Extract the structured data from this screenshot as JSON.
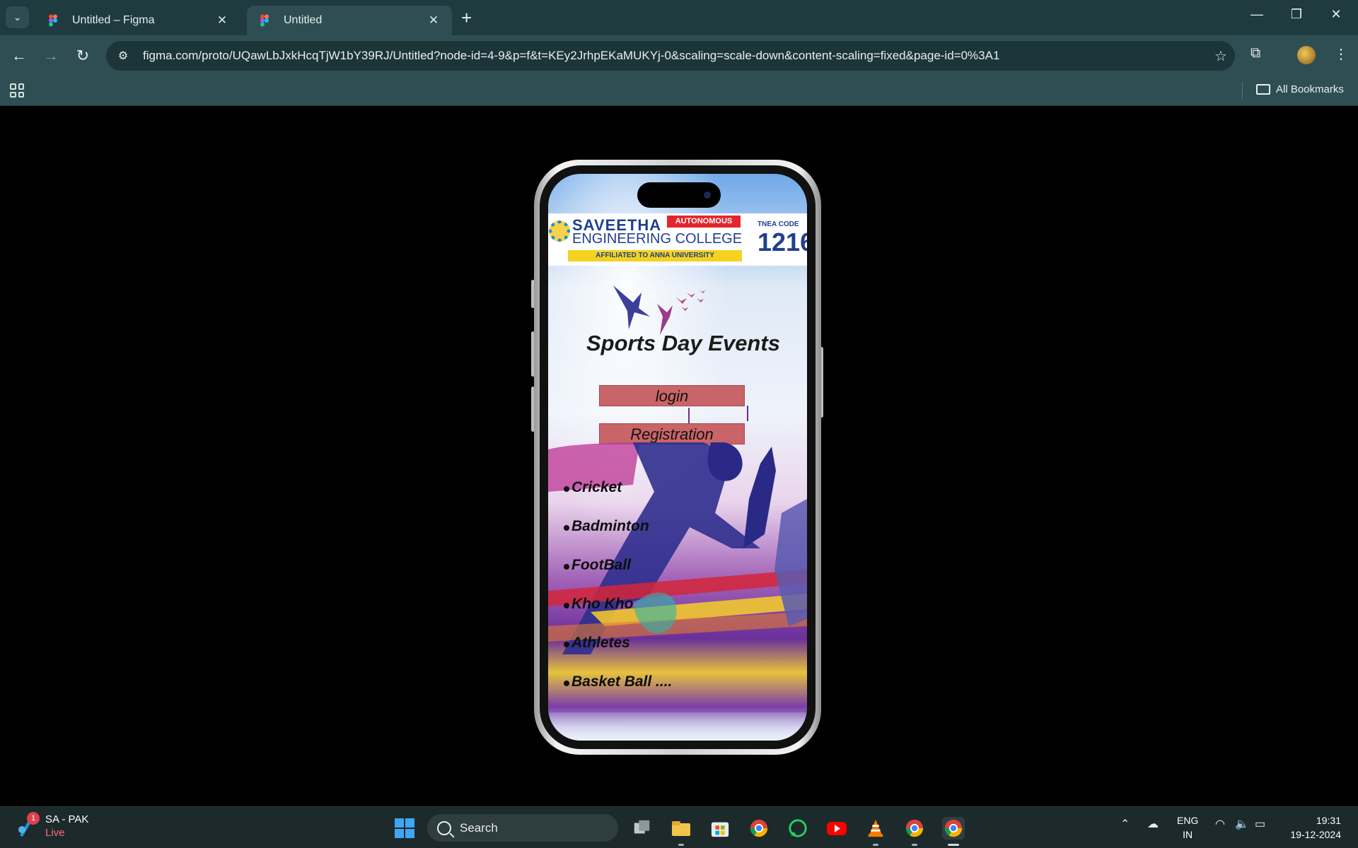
{
  "browser": {
    "tabs": [
      {
        "title": "Untitled – Figma",
        "active": false
      },
      {
        "title": "Untitled",
        "active": true
      }
    ],
    "url": "figma.com/proto/UQawLbJxkHcqTjW1bY39RJ/Untitled?node-id=4-9&p=f&t=KEy2JrhpEKaMUKYj-0&scaling=scale-down&content-scaling=fixed&page-id=0%3A1",
    "bookmarks_label": "All Bookmarks"
  },
  "app": {
    "college": {
      "name_line1": "SAVEETHA",
      "name_line2": "ENGINEERING COLLEGE",
      "autonomous": "AUTONOMOUS",
      "affiliation": "AFFILIATED TO ANNA UNIVERSITY",
      "tnea_label": "TNEA CODE",
      "tnea_code": "1216"
    },
    "heading": "Sports Day  Events",
    "buttons": {
      "login": "login",
      "registration": "Registration"
    },
    "events": [
      "Cricket",
      "Badminton",
      "FootBall",
      "Kho Kho",
      "Athletes",
      "Basket Ball ...."
    ]
  },
  "taskbar": {
    "weather": {
      "badge": "1",
      "title": "SA - PAK",
      "status": "Live"
    },
    "search_label": "Search",
    "language": {
      "line1": "ENG",
      "line2": "IN"
    },
    "clock": {
      "time": "19:31",
      "date": "19-12-2024"
    }
  },
  "colors": {
    "chrome_tabbar": "#1f3b40",
    "chrome_toolbar": "#2f4e53",
    "button_fill": "#c96468",
    "brand_blue": "#1f3f8f",
    "badge_red": "#e3262c",
    "affil_yellow": "#f4d21f"
  }
}
